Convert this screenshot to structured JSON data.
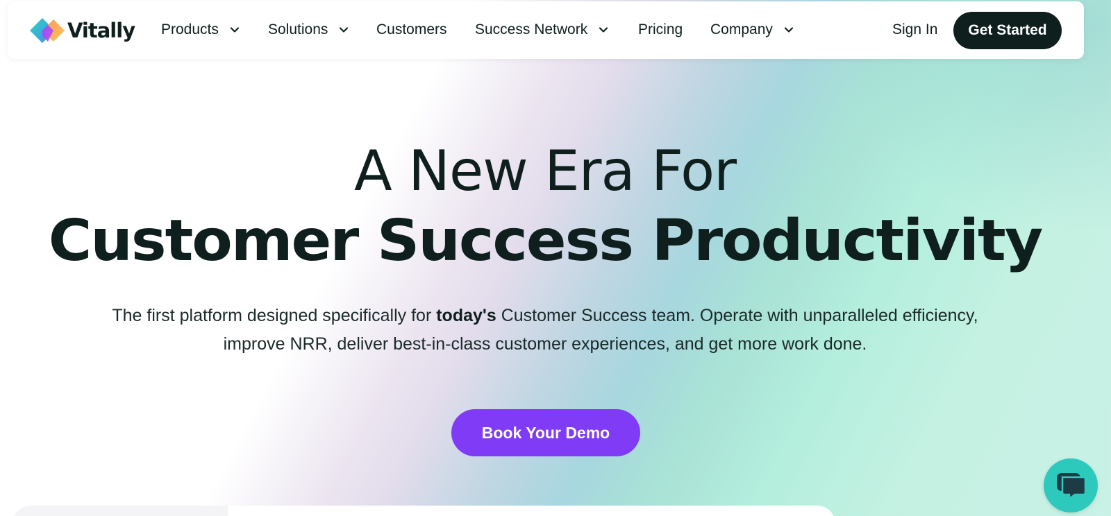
{
  "brand": {
    "name": "Vitally"
  },
  "nav": {
    "items": [
      {
        "label": "Products",
        "has_dropdown": true
      },
      {
        "label": "Solutions",
        "has_dropdown": true
      },
      {
        "label": "Customers",
        "has_dropdown": false
      },
      {
        "label": "Success Network",
        "has_dropdown": true
      },
      {
        "label": "Pricing",
        "has_dropdown": false
      },
      {
        "label": "Company",
        "has_dropdown": true
      }
    ],
    "sign_in": "Sign In",
    "get_started": "Get Started"
  },
  "hero": {
    "headline_line1": "A New Era For",
    "headline_line2": "Customer Success Productivity",
    "sub_part1": "The first platform designed specifically for ",
    "sub_bold": "today's",
    "sub_part2": " Customer Success team. Operate with unparalleled efficiency, improve NRR, deliver best-in-class customer experiences, and get more work done.",
    "cta": "Book Your Demo"
  },
  "chat": {
    "icon": "chat-bubble-icon"
  },
  "colors": {
    "dark": "#0f1f1e",
    "cta_purple": "#7f3bf5",
    "chat_teal": "#2ec9bd"
  }
}
